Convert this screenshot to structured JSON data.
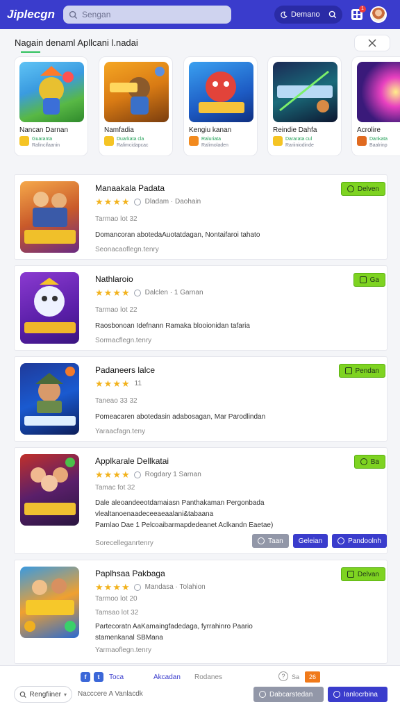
{
  "header": {
    "logo": "Jiplecgn",
    "search_placeholder": "Sengan",
    "pill_label": "Demano",
    "notif_count": "1",
    "brand_color": "#3a3ccc"
  },
  "section": {
    "title": "Nagain denaml  Apllcani l.nadai"
  },
  "carousel": [
    {
      "title": "Nancan Darnan",
      "meta1": "Guaranta",
      "meta2": "Ralincifaanin"
    },
    {
      "title": "Namfadia",
      "meta1": "Duarkata cla",
      "meta2": "Ralimcidapcac"
    },
    {
      "title": "Kengiu kanan",
      "meta1": "Raluriata",
      "meta2": "Ralimoladen"
    },
    {
      "title": "Reindie Dahfa",
      "meta1": "Dararata cul",
      "meta2": "Rariiniodinde"
    },
    {
      "title": "Acrolire",
      "meta1": "Dankata",
      "meta2": "Baalrinp"
    }
  ],
  "apps": [
    {
      "name": "Manaakala Padata",
      "rating_text": "Dladam · Daohain",
      "action": "Delven",
      "line1": "Tarmao lot 32",
      "line2": "Domancoran abotedaAuotatdagan, Nontaifaroi tahato",
      "line3": "Seonacaoflegn.tenry"
    },
    {
      "name": "Nathlaroio",
      "rating_text": "Dalclen · 1 Garnan",
      "action": "Ga",
      "line1": "Tarmao lot 22",
      "line2": "Raosbonoan Idefnann Ramaka blooionidan tafaria",
      "line3": "Sormacflegn.tenry"
    },
    {
      "name": "Padaneers lalce",
      "rating_text": "11",
      "action": "Pendan",
      "line1": "Taneao 33 32",
      "line2": "Pomeacaren abotedasin adabosagan, Mar Parodlindan",
      "line3": "Yaraacfagn.teny"
    },
    {
      "name": "Applkarale Dellkatai",
      "rating_text": "Rogdary 1 Sarnan",
      "action": "Ba",
      "line1": "Tamac fot 32",
      "line2": "Dale aleoandeeotdamaiasn Panthakaman Pergonbada",
      "line3": "vlealtanoenaadeceeaeaalani&tabaana",
      "line4": "Parnlao Dae 1 Pelcoaibarmapdedeanet Aclkandn Eaetae)",
      "line5": "Sorecelleganrtenry",
      "btn1": "Taan",
      "btn2": "Geleian",
      "btn3": "Pandoolnh"
    },
    {
      "name": "Paplhsaa Pakbaga",
      "rating_text": "Mandasa · Tolahion",
      "action": "Delvan",
      "line1": "Tarmoo lot 20",
      "line2": "Tamsao lot 32",
      "line3": "Partecoratn AaKamaingfadedaga, fyrrahinro Paario",
      "line4": "stamenkanal SBMana",
      "line5": "Yarmaoflegn.tenry"
    }
  ],
  "footer": {
    "social_label": "Toca",
    "link1": "Akcadan",
    "link2": "Rodanes",
    "help": "?",
    "badge_label": "Sa",
    "badge_value": "26",
    "language": "Rengfiiner",
    "note": "Nacccere A Vanlacdk",
    "btn_grey": "Dabcarstedan",
    "btn_blue": "Ianlocrbina"
  }
}
